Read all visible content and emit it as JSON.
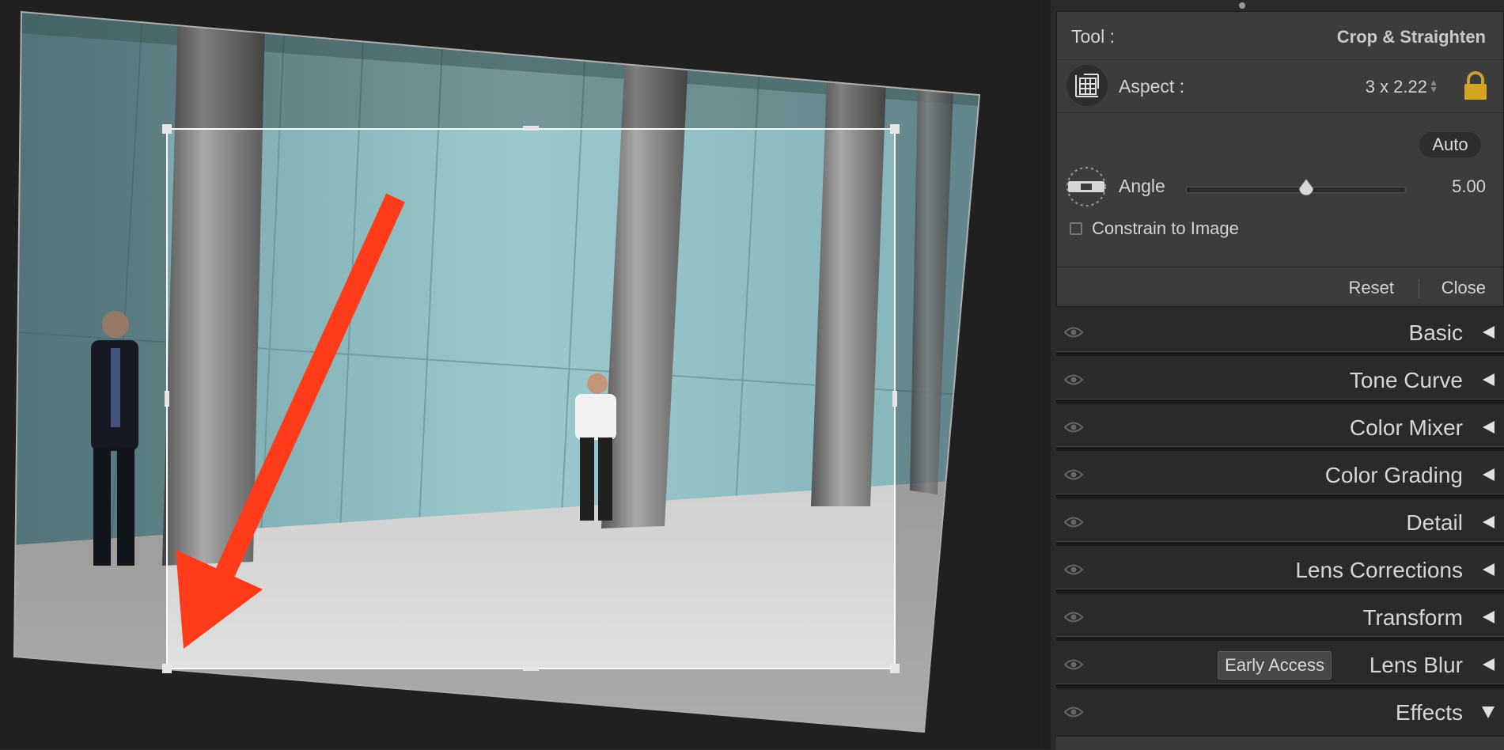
{
  "tool_panel": {
    "tool_label": "Tool :",
    "tool_value": "Crop & Straighten",
    "aspect_label": "Aspect :",
    "aspect_value": "3 x 2.22",
    "auto_label": "Auto",
    "angle_label": "Angle",
    "angle_value": "5.00",
    "angle_slider_fraction": 0.55,
    "constrain_label": "Constrain to Image",
    "constrain_checked": false,
    "reset_label": "Reset",
    "close_label": "Close",
    "lock_icon": "lock-icon",
    "crop_icon": "crop-grid-icon",
    "level_icon": "level-icon"
  },
  "sections": [
    {
      "title": "Basic",
      "icon": "triangle-left"
    },
    {
      "title": "Tone Curve",
      "icon": "triangle-left"
    },
    {
      "title": "Color Mixer",
      "icon": "triangle-left"
    },
    {
      "title": "Color Grading",
      "icon": "triangle-left"
    },
    {
      "title": "Detail",
      "icon": "triangle-left"
    },
    {
      "title": "Lens Corrections",
      "icon": "triangle-left"
    },
    {
      "title": "Transform",
      "icon": "triangle-left"
    },
    {
      "title": "Lens Blur",
      "badge": "Early Access",
      "icon": "triangle-left"
    },
    {
      "title": "Effects",
      "icon": "triangle-down"
    }
  ],
  "colors": {
    "accent_arrow": "#ff3b1a",
    "panel_bg": "#2a2a2a",
    "tool_box_bg": "#3c3c3c",
    "lock_gold": "#d4a520"
  }
}
